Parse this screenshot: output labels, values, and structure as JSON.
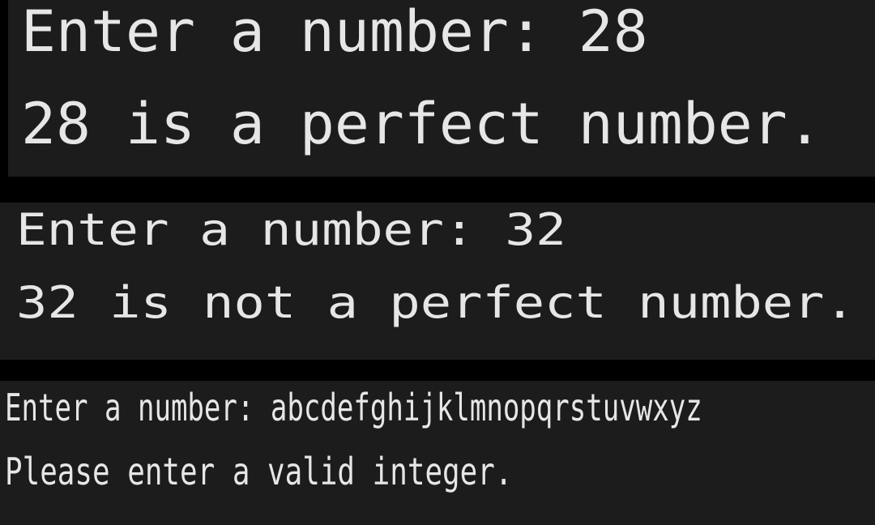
{
  "colors": {
    "background": "#000000",
    "panel": "#1c1c1c",
    "text": "#e6e6e6"
  },
  "runs": [
    {
      "prompt_line": "Enter a number: 28",
      "result_line": "28 is a perfect number."
    },
    {
      "prompt_line": "Enter a number: 32",
      "result_line": "32 is not a perfect number."
    },
    {
      "prompt_line": "Enter a number: abcdefghijklmnopqrstuvwxyz",
      "result_line": "Please enter a valid integer."
    }
  ]
}
